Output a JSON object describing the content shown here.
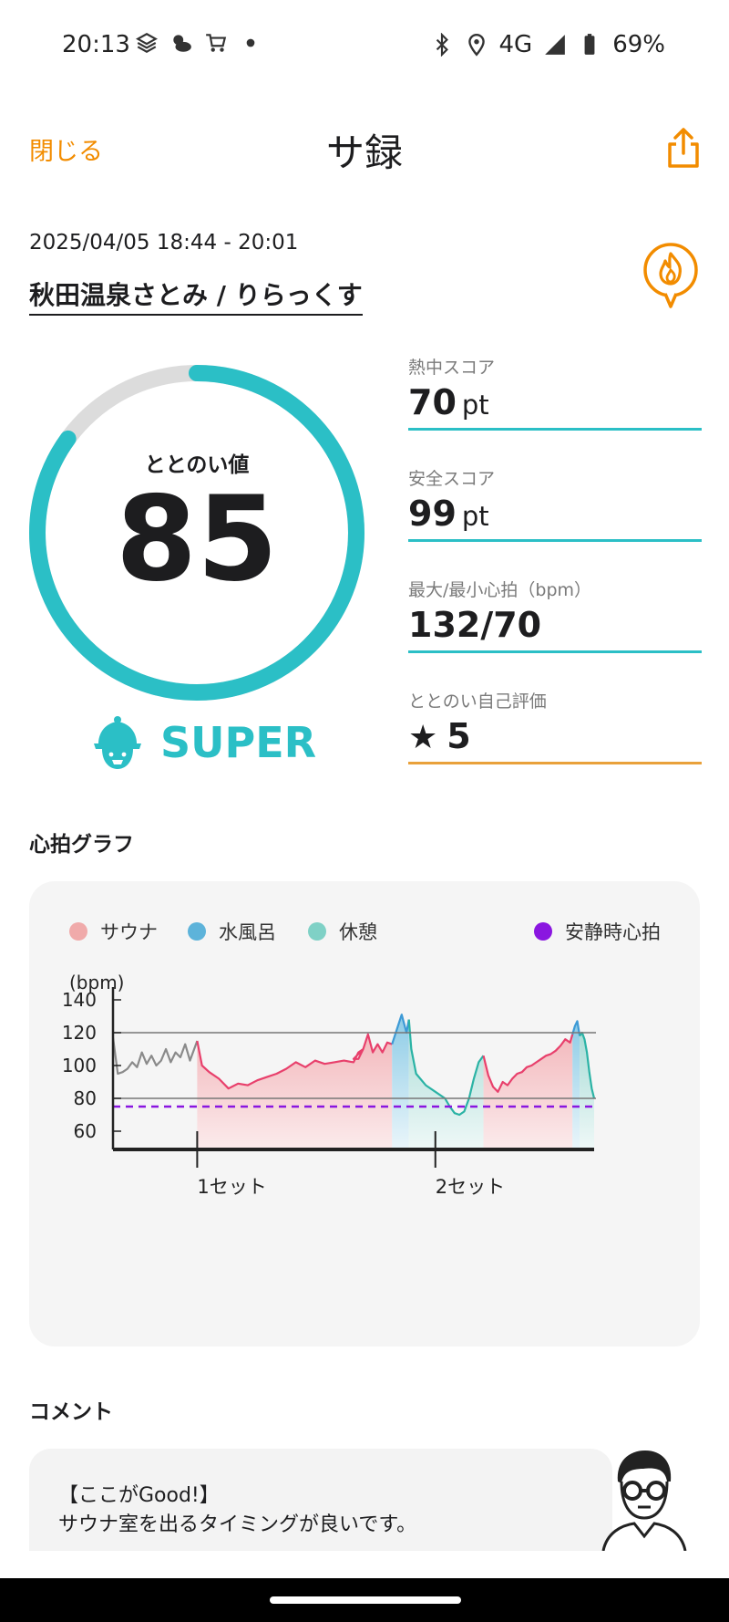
{
  "status_bar": {
    "time": "20:13",
    "network": "4G",
    "battery": "69%",
    "icons": [
      "layers-icon",
      "weather-icon",
      "cart-icon",
      "dot-icon",
      "bluetooth-icon",
      "location-icon",
      "signal-icon",
      "battery-icon"
    ]
  },
  "nav": {
    "close_label": "閉じる",
    "title": "サ録",
    "share_icon": "share-icon",
    "accent_color": "#f28c00"
  },
  "session": {
    "datetime": "2025/04/05 18:44 - 20:01",
    "facility": "秋田温泉さとみ / りらっくす"
  },
  "score": {
    "label": "ととのい値",
    "value": "85",
    "progress": 0.85,
    "rank": "SUPER",
    "color": "#2bbfc6",
    "track_color": "#dcdcdc"
  },
  "metrics": [
    {
      "label": "熱中スコア",
      "value": "70",
      "unit": "pt"
    },
    {
      "label": "安全スコア",
      "value": "99",
      "unit": "pt"
    },
    {
      "label": "最大/最小心拍（bpm）",
      "value": "132/70",
      "unit": ""
    },
    {
      "label": "ととのい自己評価",
      "value": "5",
      "unit": ""
    }
  ],
  "heart_graph": {
    "section_title": "心拍グラフ",
    "legend": [
      {
        "label": "サウナ",
        "color": "#f0aaaa"
      },
      {
        "label": "水風呂",
        "color": "#5db3da"
      },
      {
        "label": "休憩",
        "color": "#7fd1c6"
      },
      {
        "label": "安静時心拍",
        "color": "#8a16e0"
      }
    ]
  },
  "chart_data": {
    "type": "area",
    "ylabel": "(bpm)",
    "ylim": [
      50,
      150
    ],
    "yticks": [
      60,
      80,
      100,
      120,
      140
    ],
    "xticks": [
      "1セット",
      "2セット"
    ],
    "reference_lines": [
      120,
      80
    ],
    "resting_heart_rate": 75,
    "series": [
      {
        "phase": "pre",
        "points": [
          [
            0.0,
            117
          ],
          [
            0.01,
            95
          ],
          [
            0.02,
            96
          ],
          [
            0.03,
            98
          ],
          [
            0.04,
            102
          ],
          [
            0.05,
            99
          ],
          [
            0.06,
            108
          ],
          [
            0.07,
            101
          ],
          [
            0.08,
            106
          ],
          [
            0.09,
            100
          ],
          [
            0.1,
            103
          ],
          [
            0.11,
            110
          ],
          [
            0.12,
            102
          ],
          [
            0.13,
            108
          ],
          [
            0.14,
            105
          ],
          [
            0.15,
            113
          ],
          [
            0.16,
            103
          ],
          [
            0.175,
            115
          ]
        ]
      },
      {
        "phase": "sauna",
        "points": [
          [
            0.175,
            115
          ],
          [
            0.185,
            100
          ],
          [
            0.2,
            96
          ],
          [
            0.22,
            92
          ],
          [
            0.24,
            86
          ],
          [
            0.26,
            89
          ],
          [
            0.28,
            88
          ],
          [
            0.3,
            91
          ],
          [
            0.32,
            93
          ],
          [
            0.34,
            95
          ],
          [
            0.36,
            98
          ],
          [
            0.38,
            102
          ],
          [
            0.4,
            99
          ],
          [
            0.42,
            103
          ],
          [
            0.44,
            101
          ],
          [
            0.46,
            102
          ],
          [
            0.48,
            103
          ],
          [
            0.5,
            102
          ],
          [
            0.51,
            108
          ],
          [
            0.52,
            110
          ],
          [
            0.5,
            104
          ],
          [
            0.51,
            104
          ],
          [
            0.52,
            110
          ],
          [
            0.53,
            119
          ],
          [
            0.54,
            108
          ],
          [
            0.55,
            113
          ],
          [
            0.56,
            108
          ],
          [
            0.57,
            114
          ],
          [
            0.58,
            113
          ]
        ]
      },
      {
        "phase": "cold",
        "points": [
          [
            0.58,
            113
          ],
          [
            0.59,
            122
          ],
          [
            0.6,
            131
          ],
          [
            0.61,
            120
          ],
          [
            0.615,
            128
          ]
        ]
      },
      {
        "phase": "rest",
        "points": [
          [
            0.615,
            128
          ],
          [
            0.62,
            110
          ],
          [
            0.63,
            95
          ],
          [
            0.65,
            88
          ],
          [
            0.67,
            84
          ],
          [
            0.69,
            80
          ],
          [
            0.7,
            75
          ],
          [
            0.71,
            71
          ],
          [
            0.72,
            70
          ],
          [
            0.73,
            72
          ],
          [
            0.74,
            80
          ],
          [
            0.75,
            92
          ],
          [
            0.76,
            102
          ],
          [
            0.77,
            106
          ]
        ]
      },
      {
        "phase": "sauna",
        "points": [
          [
            0.77,
            106
          ],
          [
            0.78,
            94
          ],
          [
            0.79,
            87
          ],
          [
            0.8,
            84
          ],
          [
            0.81,
            90
          ],
          [
            0.82,
            88
          ],
          [
            0.83,
            92
          ],
          [
            0.84,
            95
          ],
          [
            0.85,
            96
          ],
          [
            0.86,
            99
          ],
          [
            0.87,
            100
          ],
          [
            0.88,
            102
          ],
          [
            0.89,
            104
          ],
          [
            0.9,
            106
          ],
          [
            0.91,
            107
          ],
          [
            0.92,
            109
          ],
          [
            0.93,
            112
          ],
          [
            0.94,
            116
          ],
          [
            0.95,
            114
          ],
          [
            0.955,
            119
          ]
        ]
      },
      {
        "phase": "cold",
        "points": [
          [
            0.955,
            119
          ],
          [
            0.96,
            124
          ],
          [
            0.965,
            127
          ],
          [
            0.97,
            118
          ]
        ]
      },
      {
        "phase": "rest",
        "points": [
          [
            0.97,
            118
          ],
          [
            0.975,
            120
          ],
          [
            0.98,
            116
          ],
          [
            0.985,
            108
          ],
          [
            0.99,
            96
          ],
          [
            0.995,
            86
          ],
          [
            1.0,
            80
          ]
        ]
      }
    ]
  },
  "comment": {
    "section_title": "コメント",
    "line1": "【ここがGood!】",
    "line2": "サウナ室を出るタイミングが良いです。"
  }
}
